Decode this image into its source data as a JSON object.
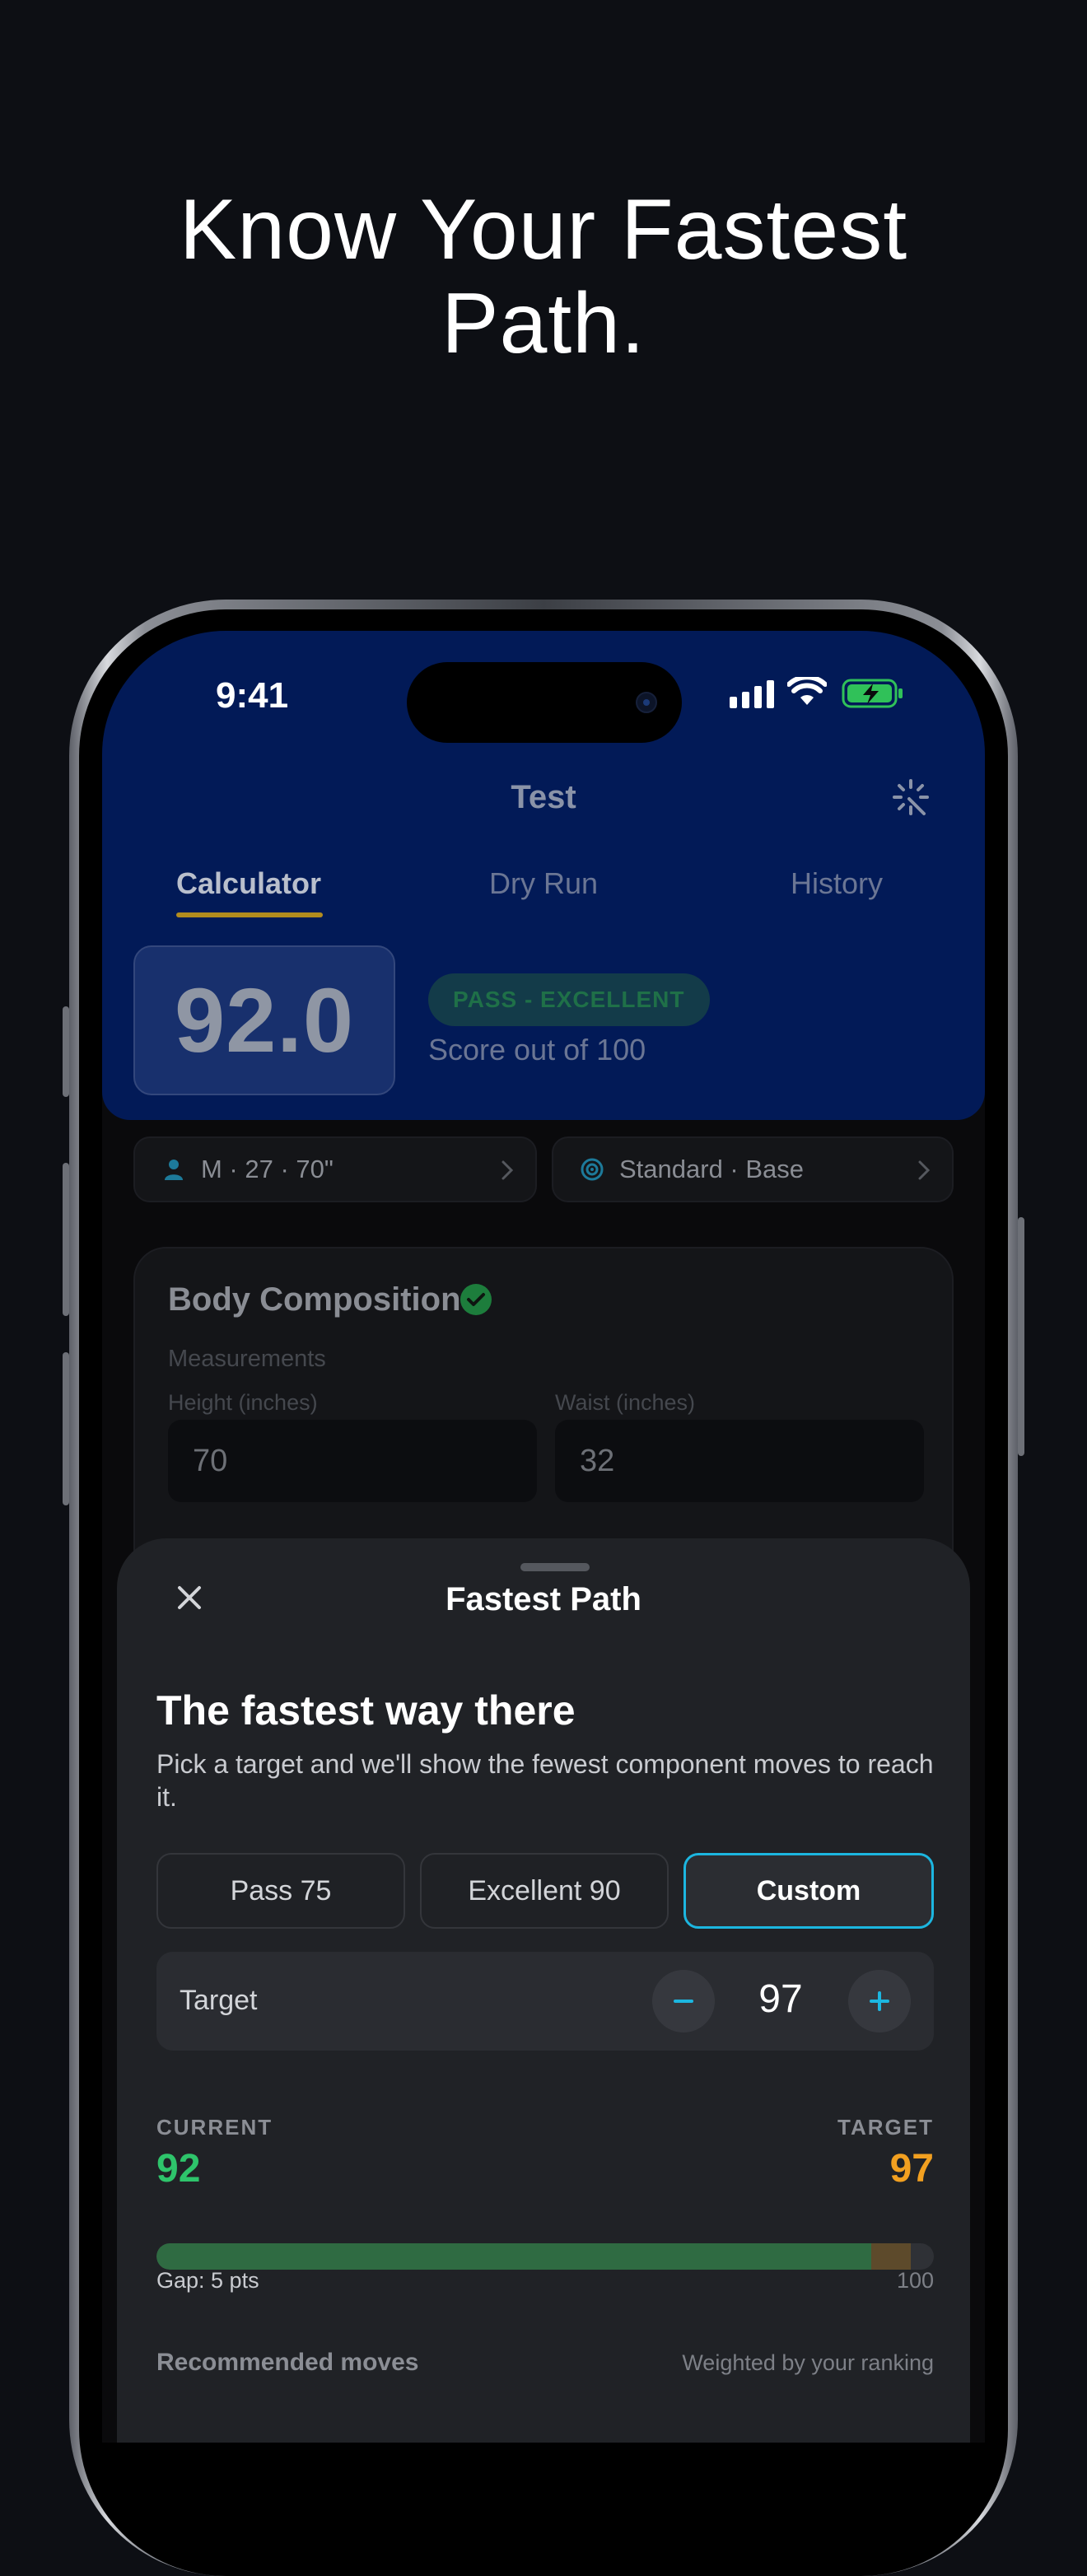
{
  "headline": {
    "line1": "Know Your Fastest",
    "line2": "Path."
  },
  "status_bar": {
    "time": "9:41"
  },
  "app": {
    "title": "Test",
    "tabs": [
      {
        "label": "Calculator",
        "active": true
      },
      {
        "label": "Dry Run",
        "active": false
      },
      {
        "label": "History",
        "active": false
      }
    ],
    "score": {
      "value": "92.0",
      "badge": "PASS - EXCELLENT",
      "subtitle": "Score out of 100"
    },
    "chips": [
      {
        "icon": "person-icon",
        "label": "M · 27 · 70\""
      },
      {
        "icon": "target-icon",
        "label": "Standard · Base"
      }
    ],
    "body_composition": {
      "title": "Body Composition",
      "section_label": "Measurements",
      "height": {
        "label": "Height (inches)",
        "value": "70"
      },
      "waist": {
        "label": "Waist (inches)",
        "value": "32"
      }
    }
  },
  "sheet": {
    "title": "Fastest Path",
    "heading": "The fastest way there",
    "description": "Pick a target and we'll show the fewest component moves to reach it.",
    "presets": [
      {
        "label": "Pass 75",
        "selected": false
      },
      {
        "label": "Excellent 90",
        "selected": false
      },
      {
        "label": "Custom",
        "selected": true
      }
    ],
    "target_row": {
      "label": "Target",
      "value": "97"
    },
    "progress": {
      "current_label": "CURRENT",
      "current_value": "92",
      "target_label": "TARGET",
      "target_value": "97",
      "current": 92,
      "target": 97,
      "max": 100,
      "gap_text": "Gap: 5 pts",
      "max_text": "100"
    },
    "recommended": {
      "label": "Recommended moves",
      "note": "Weighted by your ranking"
    }
  },
  "colors": {
    "hero_bg": "#021a57",
    "accent_cyan": "#1cb6e0",
    "current_green": "#2ec46b",
    "target_orange": "#f2a020",
    "tab_underline": "#b38c1e"
  }
}
